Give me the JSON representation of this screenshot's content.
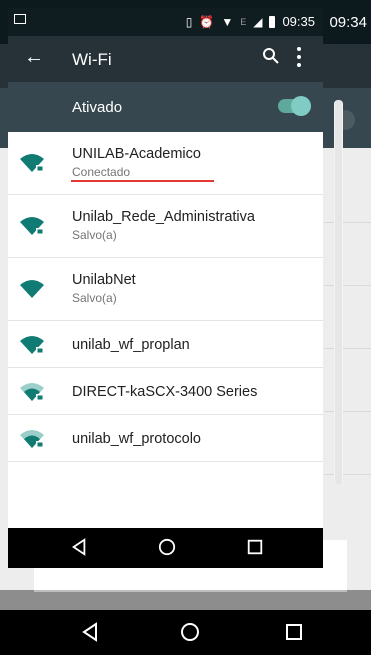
{
  "status_bar": {
    "time": "09:35"
  },
  "background_status": {
    "time": "09:34"
  },
  "toolbar": {
    "title": "Wi-Fi",
    "back_icon": "arrow-back-icon",
    "search_icon": "search-icon",
    "more_icon": "more-vert-icon"
  },
  "wifi_switch": {
    "label": "Ativado",
    "state": "on",
    "accent": "#80cbc4"
  },
  "networks": [
    {
      "ssid": "UNILAB-Academico",
      "status": "Conectado",
      "secured": true,
      "signal": "full"
    },
    {
      "ssid": "Unilab_Rede_Administrativa",
      "status": "Salvo(a)",
      "secured": true,
      "signal": "full"
    },
    {
      "ssid": "UnilabNet",
      "status": "Salvo(a)",
      "secured": false,
      "signal": "full"
    },
    {
      "ssid": "unilab_wf_proplan",
      "status": "",
      "secured": true,
      "signal": "full"
    },
    {
      "ssid": "DIRECT-kaSCX-3400 Series",
      "status": "",
      "secured": true,
      "signal": "medium"
    },
    {
      "ssid": "unilab_wf_protocolo",
      "status": "",
      "secured": true,
      "signal": "medium"
    }
  ],
  "colors": {
    "toolbar": "#263238",
    "switchbar": "#37474f",
    "wifi_icon": "#0f7b72",
    "underline": "#e53935"
  }
}
